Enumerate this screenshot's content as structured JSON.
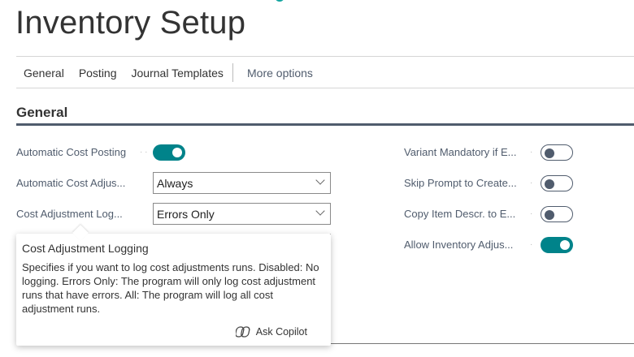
{
  "page": {
    "title": "Inventory Setup"
  },
  "nav": {
    "tabs": [
      "General",
      "Posting",
      "Journal Templates"
    ],
    "more": "More options"
  },
  "section": {
    "title": "General"
  },
  "left_fields": {
    "automatic_cost_posting": {
      "label": "Automatic Cost Posting",
      "value": true
    },
    "automatic_cost_adjustment": {
      "label": "Automatic Cost Adjus...",
      "value": "Always"
    },
    "cost_adjustment_logging": {
      "label": "Cost Adjustment Log...",
      "value": "Errors Only"
    }
  },
  "right_fields": [
    {
      "label": "Variant Mandatory if E...",
      "value": false
    },
    {
      "label": "Skip Prompt to Create...",
      "value": false
    },
    {
      "label": "Copy Item Descr. to E...",
      "value": false
    },
    {
      "label": "Allow Inventory Adjus...",
      "value": true
    }
  ],
  "tooltip": {
    "title": "Cost Adjustment Logging",
    "body": "Specifies if you want to log cost adjustments runs. Disabled: No logging. Errors Only: The program will only log cost adjustment runs that have errors. All: The program will log all cost adjustment runs.",
    "ask_copilot": "Ask Copilot"
  },
  "colors": {
    "accent": "#00838a",
    "section_line": "#505c6d"
  }
}
